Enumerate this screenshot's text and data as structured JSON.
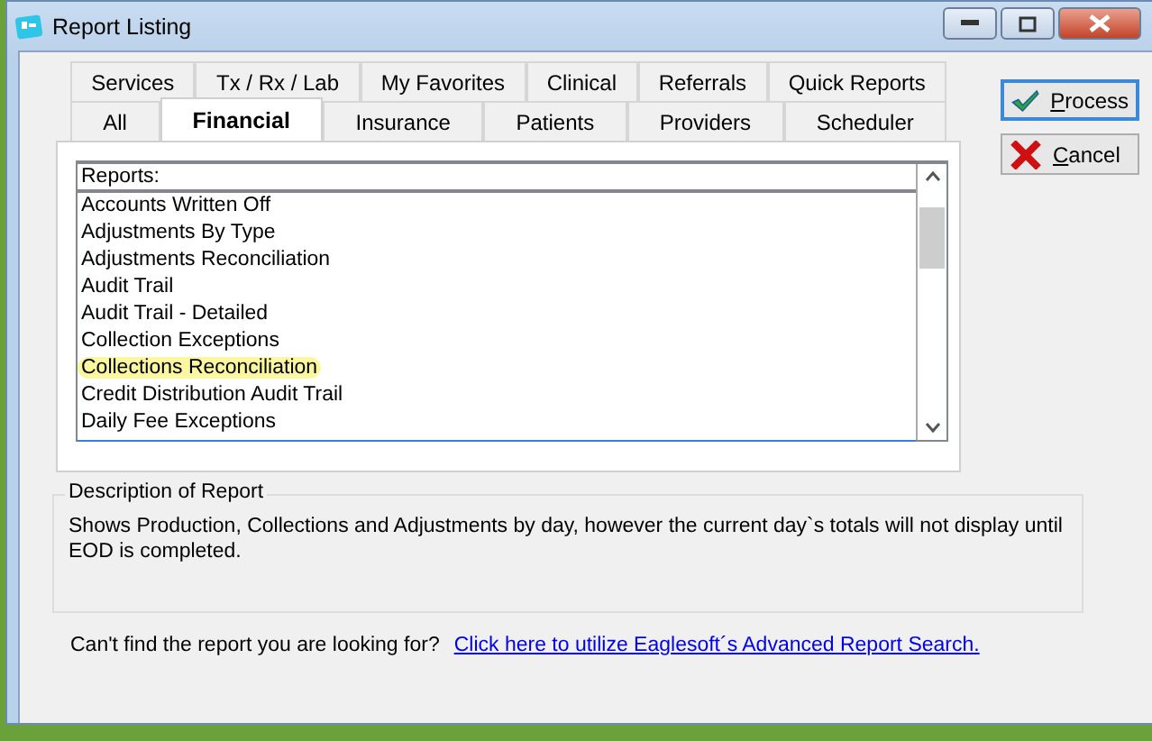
{
  "window": {
    "title": "Report Listing"
  },
  "tabs": {
    "rows": [
      [
        {
          "label": "Services",
          "selected": false
        },
        {
          "label": "Tx / Rx / Lab",
          "selected": false
        },
        {
          "label": "My Favorites",
          "selected": false
        },
        {
          "label": "Clinical",
          "selected": false
        },
        {
          "label": "Referrals",
          "selected": false
        },
        {
          "label": "Quick Reports",
          "selected": false
        }
      ],
      [
        {
          "label": "All",
          "selected": false
        },
        {
          "label": "Financial",
          "selected": true
        },
        {
          "label": "Insurance",
          "selected": false
        },
        {
          "label": "Patients",
          "selected": false
        },
        {
          "label": "Providers",
          "selected": false
        },
        {
          "label": "Scheduler",
          "selected": false
        }
      ]
    ]
  },
  "reports": {
    "header": "Reports:",
    "items": [
      {
        "label": "Accounts Written Off",
        "highlighted": false
      },
      {
        "label": "Adjustments By Type",
        "highlighted": false
      },
      {
        "label": "Adjustments Reconciliation",
        "highlighted": false
      },
      {
        "label": "Audit Trail",
        "highlighted": false
      },
      {
        "label": "Audit Trail - Detailed",
        "highlighted": false
      },
      {
        "label": "Collection Exceptions",
        "highlighted": false
      },
      {
        "label": "Collections Reconciliation",
        "highlighted": true
      },
      {
        "label": "Credit Distribution Audit Trail",
        "highlighted": false
      },
      {
        "label": "Daily Fee Exceptions",
        "highlighted": false
      }
    ]
  },
  "buttons": [
    {
      "kind": "process",
      "access_key": "P",
      "label_rest": "rocess",
      "focused": true
    },
    {
      "kind": "cancel",
      "access_key": "C",
      "label_rest": "ancel",
      "focused": false
    }
  ],
  "description": {
    "title": "Description of Report",
    "text": "Shows Production, Collections and Adjustments by day, however the current day`s totals will not display until EOD is completed."
  },
  "footer": {
    "prompt": "Can't find the report you are looking for?",
    "link": "Click here to utilize Eaglesoft´s Advanced Report Search."
  }
}
